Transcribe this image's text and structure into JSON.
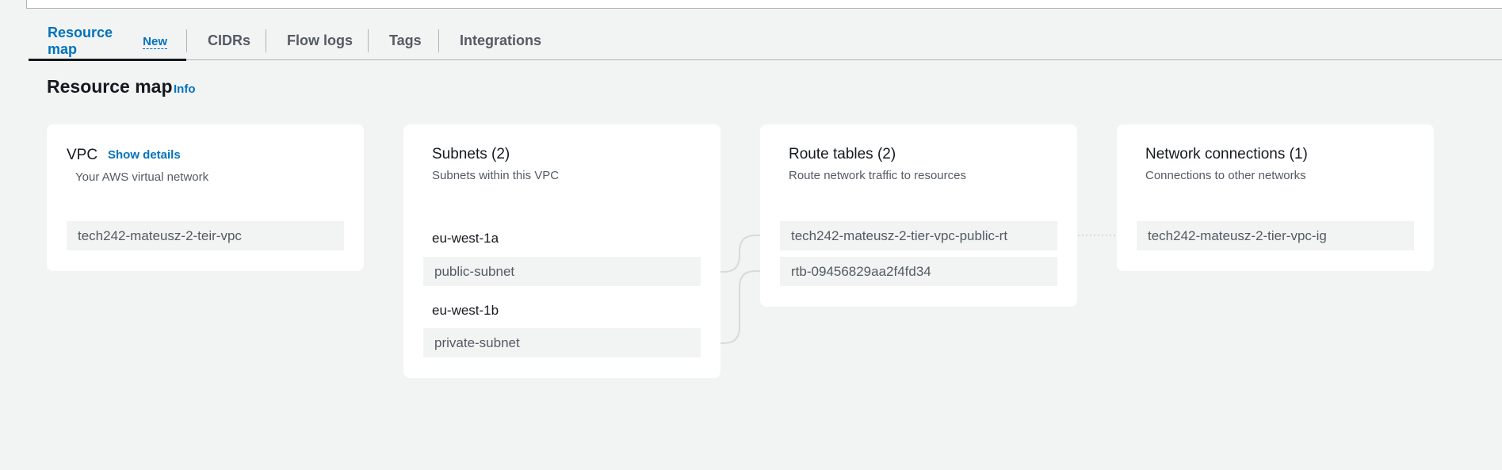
{
  "tabs": [
    {
      "label": "Resource map",
      "badge": "New",
      "active": true
    },
    {
      "label": "CIDRs",
      "active": false
    },
    {
      "label": "Flow logs",
      "active": false
    },
    {
      "label": "Tags",
      "active": false
    },
    {
      "label": "Integrations",
      "active": false
    }
  ],
  "header": {
    "title": "Resource map",
    "info_label": "Info"
  },
  "vpc_card": {
    "title": "VPC",
    "show_details_label": "Show details",
    "subtitle": "Your AWS virtual network",
    "vpc_name": "tech242-mateusz-2-teir-vpc"
  },
  "subnets_card": {
    "title": "Subnets (2)",
    "subtitle": "Subnets within this VPC",
    "zones": [
      {
        "az": "eu-west-1a",
        "subnet": "public-subnet"
      },
      {
        "az": "eu-west-1b",
        "subnet": "private-subnet"
      }
    ]
  },
  "route_tables_card": {
    "title": "Route tables (2)",
    "subtitle": "Route network traffic to resources",
    "items": [
      "tech242-mateusz-2-tier-vpc-public-rt",
      "rtb-09456829aa2f4fd34"
    ]
  },
  "network_card": {
    "title": "Network connections (1)",
    "subtitle": "Connections to other networks",
    "items": [
      "tech242-mateusz-2-tier-vpc-ig"
    ]
  },
  "colors": {
    "background": "#f2f3f3",
    "link": "#0073bb",
    "connector": "#d5dbdb"
  }
}
